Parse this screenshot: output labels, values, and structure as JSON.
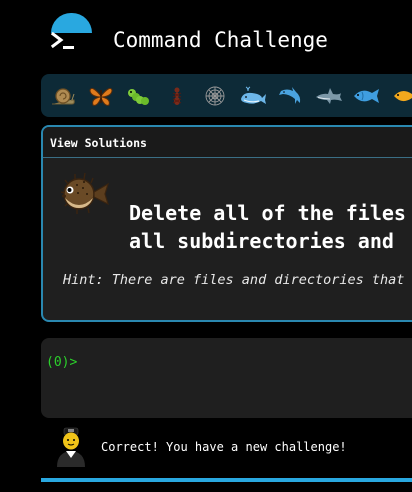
{
  "header": {
    "title": "Command Challenge",
    "logo_icon": "terminal-icon",
    "accent": "#29a8e0"
  },
  "levels": [
    {
      "name": "snail",
      "icon": "snail-icon"
    },
    {
      "name": "butterfly",
      "icon": "butterfly-icon"
    },
    {
      "name": "caterpillar",
      "icon": "caterpillar-icon"
    },
    {
      "name": "ant",
      "icon": "ant-icon"
    },
    {
      "name": "spider-web",
      "icon": "spider-web-icon"
    },
    {
      "name": "whale",
      "icon": "whale-icon"
    },
    {
      "name": "dolphin",
      "icon": "dolphin-icon"
    },
    {
      "name": "shark",
      "icon": "shark-icon"
    },
    {
      "name": "fish",
      "icon": "fish-icon"
    },
    {
      "name": "tropical-fish",
      "icon": "tropical-fish-icon"
    }
  ],
  "challenge": {
    "view_solutions": "View Solutions",
    "line1": "Delete all of the files",
    "line2": "all subdirectories and",
    "hint": "Hint: There are files and directories that",
    "mascot_icon": "pufferfish-icon"
  },
  "terminal": {
    "prompt": "(0)>"
  },
  "footer": {
    "message": "Correct! You have a new challenge!",
    "avatar_icon": "sailor-avatar-icon",
    "progress": 1.0
  },
  "colors": {
    "background": "#000000",
    "panel": "#1f1f1f",
    "border": "#2a88b0",
    "prompt": "#2bd02b"
  }
}
